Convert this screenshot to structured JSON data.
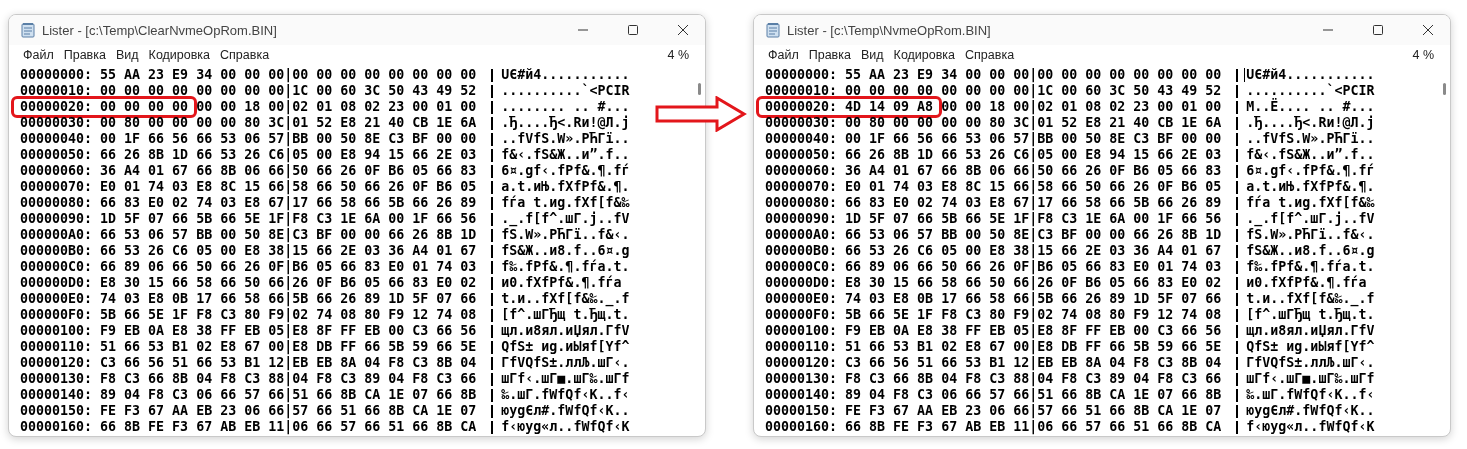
{
  "windows": [
    {
      "title": "Lister - [c:\\Temp\\ClearNvmeOpRom.BIN]",
      "menu": [
        "Файл",
        "Правка",
        "Вид",
        "Кодировка",
        "Справка"
      ],
      "zoom": "4 %",
      "text_cursor": false,
      "rows": [
        {
          "offset": "00000000:",
          "hex": "55 AA 23 E9 34 00 00 00|00 00 00 00 00 00 00 00",
          "ascii": "UЄ#й4...........",
          "highlighted": false
        },
        {
          "offset": "00000010:",
          "hex": "00 00 00 00 00 00 00 00|1C 00 60 3C 50 43 49 52",
          "ascii": "..........`<PCIR",
          "highlighted": false
        },
        {
          "offset": "00000020:",
          "hex": "00 00 00 00 00 00 18 00|02 01 08 02 23 00 01 00",
          "ascii": "........ .. #...",
          "highlighted": true
        },
        {
          "offset": "00000030:",
          "hex": "00 80 00 00 00 00 80 3C|01 52 E8 21 40 CB 1E 6A",
          "ascii": ".Ђ....Ђ<.Rи!@Л.j",
          "highlighted": false
        },
        {
          "offset": "00000040:",
          "hex": "00 1F 66 56 66 53 06 57|BB 00 50 8E C3 BF 00 00",
          "ascii": "..fVfS.W».PЋГї..",
          "highlighted": false
        },
        {
          "offset": "00000050:",
          "hex": "66 26 8B 1D 66 53 26 C6|05 00 E8 94 15 66 2E 03",
          "ascii": "f&‹.fS&Ж..и”.f..",
          "highlighted": false
        },
        {
          "offset": "00000060:",
          "hex": "36 A4 01 67 66 8B 06 66|50 66 26 0F B6 05 66 83",
          "ascii": "6¤.gf‹.fPf&.¶.fѓ",
          "highlighted": false
        },
        {
          "offset": "00000070:",
          "hex": "E0 01 74 03 E8 8C 15 66|58 66 50 66 26 0F B6 05",
          "ascii": "а.t.иЊ.fXfPf&.¶.",
          "highlighted": false
        },
        {
          "offset": "00000080:",
          "hex": "66 83 E0 02 74 03 E8 67|17 66 58 66 5B 66 26 89",
          "ascii": "fѓа t.иg.fXf[f&‰",
          "highlighted": false
        },
        {
          "offset": "00000090:",
          "hex": "1D 5F 07 66 5B 66 5E 1F|F8 C3 1E 6A 00 1F 66 56",
          "ascii": "._.f[f^.шГ.j..fV",
          "highlighted": false
        },
        {
          "offset": "000000A0:",
          "hex": "66 53 06 57 BB 00 50 8E|C3 BF 00 00 66 26 8B 1D",
          "ascii": "fS.W».PЋГї..f&‹.",
          "highlighted": false
        },
        {
          "offset": "000000B0:",
          "hex": "66 53 26 C6 05 00 E8 38|15 66 2E 03 36 A4 01 67",
          "ascii": "fS&Ж..и8.f..6¤.g",
          "highlighted": false
        },
        {
          "offset": "000000C0:",
          "hex": "66 89 06 66 50 66 26 0F|B6 05 66 83 E0 01 74 03",
          "ascii": "f‰.fPf&.¶.fѓа.t.",
          "highlighted": false
        },
        {
          "offset": "000000D0:",
          "hex": "E8 30 15 66 58 66 50 66|26 0F B6 05 66 83 E0 02",
          "ascii": "и0.fXfPf&.¶.fѓа",
          "highlighted": false
        },
        {
          "offset": "000000E0:",
          "hex": "74 03 E8 0B 17 66 58 66|5B 66 26 89 1D 5F 07 66",
          "ascii": "t.и..fXf[f&‰._.f",
          "highlighted": false
        },
        {
          "offset": "000000F0:",
          "hex": "5B 66 5E 1F F8 C3 80 F9|02 74 08 80 F9 12 74 08",
          "ascii": "[f^.шГЂщ t.Ђщ.t.",
          "highlighted": false
        },
        {
          "offset": "00000100:",
          "hex": "F9 EB 0A E8 38 FF EB 05|E8 8F FF EB 00 C3 66 56",
          "ascii": "щл.и8ял.иЏял.ГfV",
          "highlighted": false
        },
        {
          "offset": "00000110:",
          "hex": "51 66 53 B1 02 E8 67 00|E8 DB FF 66 5B 59 66 5E",
          "ascii": "QfS± иg.иЫяf[Yf^",
          "highlighted": false
        },
        {
          "offset": "00000120:",
          "hex": "C3 66 56 51 66 53 B1 12|EB EB 8A 04 F8 C3 8B 04",
          "ascii": "ГfVQfS±.ллЉ.шГ‹.",
          "highlighted": false
        },
        {
          "offset": "00000130:",
          "hex": "F8 C3 66 8B 04 F8 C3 88|04 F8 C3 89 04 F8 C3 66",
          "ascii": "шГf‹.шГ■.шГ‰.шГf",
          "highlighted": false
        },
        {
          "offset": "00000140:",
          "hex": "89 04 F8 C3 06 66 57 66|51 66 8B CA 1E 07 66 8B",
          "ascii": "‰.шГ.fWfQf‹К..f‹",
          "highlighted": false
        },
        {
          "offset": "00000150:",
          "hex": "FE F3 67 AA EB 23 06 66|57 66 51 66 8B CA 1E 07",
          "ascii": "юуgЄл#.fWfQf‹К..",
          "highlighted": false
        },
        {
          "offset": "00000160:",
          "hex": "66 8B FE F3 67 AB EB 11|06 66 57 66 51 66 8B CA",
          "ascii": "f‹юуg«л..fWfQf‹К",
          "highlighted": false
        }
      ]
    },
    {
      "title": "Lister - [c:\\Temp\\NvmeOpRom.BIN]",
      "menu": [
        "Файл",
        "Правка",
        "Вид",
        "Кодировка",
        "Справка"
      ],
      "zoom": "4 %",
      "text_cursor": true,
      "rows": [
        {
          "offset": "00000000:",
          "hex": "55 AA 23 E9 34 00 00 00|00 00 00 00 00 00 00 00",
          "ascii": "UЄ#й4...........",
          "highlighted": false
        },
        {
          "offset": "00000010:",
          "hex": "00 00 00 00 00 00 00 00|1C 00 60 3C 50 43 49 52",
          "ascii": "..........`<PCIR",
          "highlighted": false
        },
        {
          "offset": "00000020:",
          "hex": "4D 14 09 A8 00 00 18 00|02 01 08 02 23 00 01 00",
          "ascii": "M..Ё.... .. #...",
          "highlighted": true
        },
        {
          "offset": "00000030:",
          "hex": "00 80 00 00 00 00 80 3C|01 52 E8 21 40 CB 1E 6A",
          "ascii": ".Ђ....Ђ<.Rи!@Л.j",
          "highlighted": false
        },
        {
          "offset": "00000040:",
          "hex": "00 1F 66 56 66 53 06 57|BB 00 50 8E C3 BF 00 00",
          "ascii": "..fVfS.W».PЋГї..",
          "highlighted": false
        },
        {
          "offset": "00000050:",
          "hex": "66 26 8B 1D 66 53 26 C6|05 00 E8 94 15 66 2E 03",
          "ascii": "f&‹.fS&Ж..и”.f..",
          "highlighted": false
        },
        {
          "offset": "00000060:",
          "hex": "36 A4 01 67 66 8B 06 66|50 66 26 0F B6 05 66 83",
          "ascii": "6¤.gf‹.fPf&.¶.fѓ",
          "highlighted": false
        },
        {
          "offset": "00000070:",
          "hex": "E0 01 74 03 E8 8C 15 66|58 66 50 66 26 0F B6 05",
          "ascii": "а.t.иЊ.fXfPf&.¶.",
          "highlighted": false
        },
        {
          "offset": "00000080:",
          "hex": "66 83 E0 02 74 03 E8 67|17 66 58 66 5B 66 26 89",
          "ascii": "fѓа t.иg.fXf[f&‰",
          "highlighted": false
        },
        {
          "offset": "00000090:",
          "hex": "1D 5F 07 66 5B 66 5E 1F|F8 C3 1E 6A 00 1F 66 56",
          "ascii": "._.f[f^.шГ.j..fV",
          "highlighted": false
        },
        {
          "offset": "000000A0:",
          "hex": "66 53 06 57 BB 00 50 8E|C3 BF 00 00 66 26 8B 1D",
          "ascii": "fS.W».PЋГї..f&‹.",
          "highlighted": false
        },
        {
          "offset": "000000B0:",
          "hex": "66 53 26 C6 05 00 E8 38|15 66 2E 03 36 A4 01 67",
          "ascii": "fS&Ж..и8.f..6¤.g",
          "highlighted": false
        },
        {
          "offset": "000000C0:",
          "hex": "66 89 06 66 50 66 26 0F|B6 05 66 83 E0 01 74 03",
          "ascii": "f‰.fPf&.¶.fѓа.t.",
          "highlighted": false
        },
        {
          "offset": "000000D0:",
          "hex": "E8 30 15 66 58 66 50 66|26 0F B6 05 66 83 E0 02",
          "ascii": "и0.fXfPf&.¶.fѓа",
          "highlighted": false
        },
        {
          "offset": "000000E0:",
          "hex": "74 03 E8 0B 17 66 58 66|5B 66 26 89 1D 5F 07 66",
          "ascii": "t.и..fXf[f&‰._.f",
          "highlighted": false
        },
        {
          "offset": "000000F0:",
          "hex": "5B 66 5E 1F F8 C3 80 F9|02 74 08 80 F9 12 74 08",
          "ascii": "[f^.шГЂщ t.Ђщ.t.",
          "highlighted": false
        },
        {
          "offset": "00000100:",
          "hex": "F9 EB 0A E8 38 FF EB 05|E8 8F FF EB 00 C3 66 56",
          "ascii": "щл.и8ял.иЏял.ГfV",
          "highlighted": false
        },
        {
          "offset": "00000110:",
          "hex": "51 66 53 B1 02 E8 67 00|E8 DB FF 66 5B 59 66 5E",
          "ascii": "QfS± иg.иЫяf[Yf^",
          "highlighted": false
        },
        {
          "offset": "00000120:",
          "hex": "C3 66 56 51 66 53 B1 12|EB EB 8A 04 F8 C3 8B 04",
          "ascii": "ГfVQfS±.ллЉ.шГ‹.",
          "highlighted": false
        },
        {
          "offset": "00000130:",
          "hex": "F8 C3 66 8B 04 F8 C3 88|04 F8 C3 89 04 F8 C3 66",
          "ascii": "шГf‹.шГ■.шГ‰.шГf",
          "highlighted": false
        },
        {
          "offset": "00000140:",
          "hex": "89 04 F8 C3 06 66 57 66|51 66 8B CA 1E 07 66 8B",
          "ascii": "‰.шГ.fWfQf‹К..f‹",
          "highlighted": false
        },
        {
          "offset": "00000150:",
          "hex": "FE F3 67 AA EB 23 06 66|57 66 51 66 8B CA 1E 07",
          "ascii": "юуgЄл#.fWfQf‹К..",
          "highlighted": false
        },
        {
          "offset": "00000160:",
          "hex": "66 8B FE F3 67 AB EB 11|06 66 57 66 51 66 8B CA",
          "ascii": "f‹юуg«л..fWfQf‹К",
          "highlighted": false
        }
      ]
    }
  ]
}
